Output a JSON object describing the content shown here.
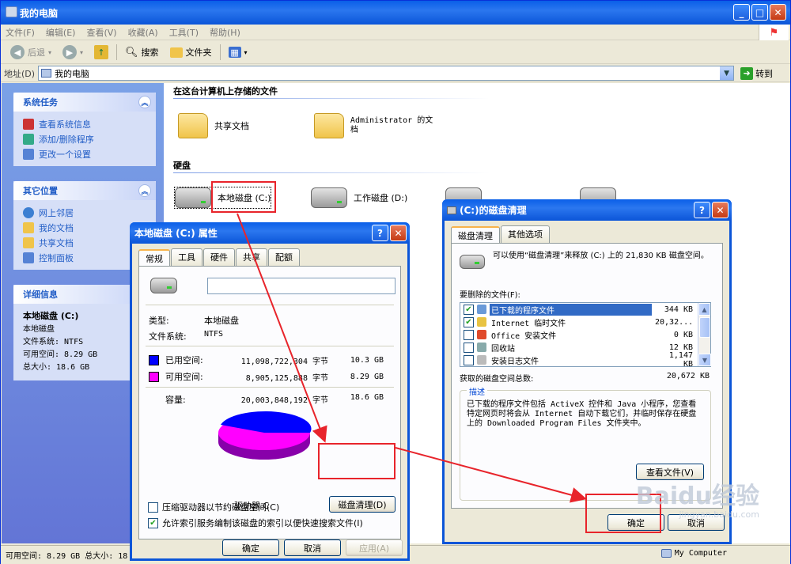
{
  "explorer": {
    "title": "我的电脑",
    "menu": [
      "文件(F)",
      "编辑(E)",
      "查看(V)",
      "收藏(A)",
      "工具(T)",
      "帮助(H)"
    ],
    "toolbar": {
      "back": "后退",
      "search": "搜索",
      "folders": "文件夹"
    },
    "address": {
      "label": "地址(D)",
      "value": "我的电脑",
      "go": "转到"
    },
    "taskpane": {
      "system_tasks": {
        "title": "系统任务",
        "items": [
          "查看系统信息",
          "添加/删除程序",
          "更改一个设置"
        ]
      },
      "other_places": {
        "title": "其它位置",
        "items": [
          "网上邻居",
          "我的文档",
          "共享文档",
          "控制面板"
        ]
      },
      "details": {
        "title": "详细信息",
        "name": "本地磁盘 (C:)",
        "type": "本地磁盘",
        "fs": "文件系统: NTFS",
        "free": "可用空间: 8.29 GB",
        "total": "总大小: 18.6 GB"
      }
    },
    "content": {
      "files_header": "在这台计算机上存储的文件",
      "shared_docs": "共享文档",
      "admin_docs": "Administrator 的文档",
      "disks_header": "硬盘",
      "drive_c": "本地磁盘 (C:)",
      "drive_d": "工作磁盘 (D:)"
    },
    "status": {
      "left": "可用空间: 8.29 GB 总大小: 18",
      "right": "My Computer"
    }
  },
  "properties": {
    "title": "本地磁盘 (C:) 属性",
    "tabs": [
      "常规",
      "工具",
      "硬件",
      "共享",
      "配额"
    ],
    "type_label": "类型:",
    "type_value": "本地磁盘",
    "fs_label": "文件系统:",
    "fs_value": "NTFS",
    "used_label": "已用空间:",
    "used_bytes": "11,098,722,304 字节",
    "used_gb": "10.3 GB",
    "free_label": "可用空间:",
    "free_bytes": "8,905,125,888 字节",
    "free_gb": "8.29 GB",
    "cap_label": "容量:",
    "cap_bytes": "20,003,848,192 字节",
    "cap_gb": "18.6 GB",
    "drive_label": "驱动器 C",
    "cleanup_btn": "磁盘清理(D)",
    "compress": "压缩驱动器以节约磁盘空间(C)",
    "index": "允许索引服务编制该磁盘的索引以便快速搜索文件(I)",
    "ok": "确定",
    "cancel": "取消",
    "apply": "应用(A)",
    "used_color": "#0000ff",
    "free_color": "#ff00ff"
  },
  "cleanup": {
    "title": "(C:)的磁盘清理",
    "tabs": [
      "磁盘清理",
      "其他选项"
    ],
    "intro": "可以使用“磁盘清理”来释放 (C:) 上的 21,830 KB 磁盘空间。",
    "files_label": "要删除的文件(F):",
    "files": [
      {
        "name": "已下载的程序文件",
        "size": "344 KB",
        "checked": true
      },
      {
        "name": "Internet 临时文件",
        "size": "20,32...",
        "checked": true
      },
      {
        "name": "Office 安装文件",
        "size": "0 KB",
        "checked": false
      },
      {
        "name": "回收站",
        "size": "12 KB",
        "checked": false
      },
      {
        "name": "安装日志文件",
        "size": "1,147 KB",
        "checked": false
      }
    ],
    "total_label": "获取的磁盘空间总数:",
    "total_value": "20,672 KB",
    "desc_label": "描述",
    "desc_text": "已下载的程序文件包括 ActiveX 控件和 Java 小程序，您查看特定网页时将会从 Internet 自动下载它们，并临时保存在硬盘上的 Downloaded Program Files 文件夹中。",
    "view_files": "查看文件(V)",
    "ok": "确定",
    "cancel": "取消"
  },
  "watermark": {
    "brand": "Baidu经验",
    "url": "jingyan.baidu.com"
  }
}
